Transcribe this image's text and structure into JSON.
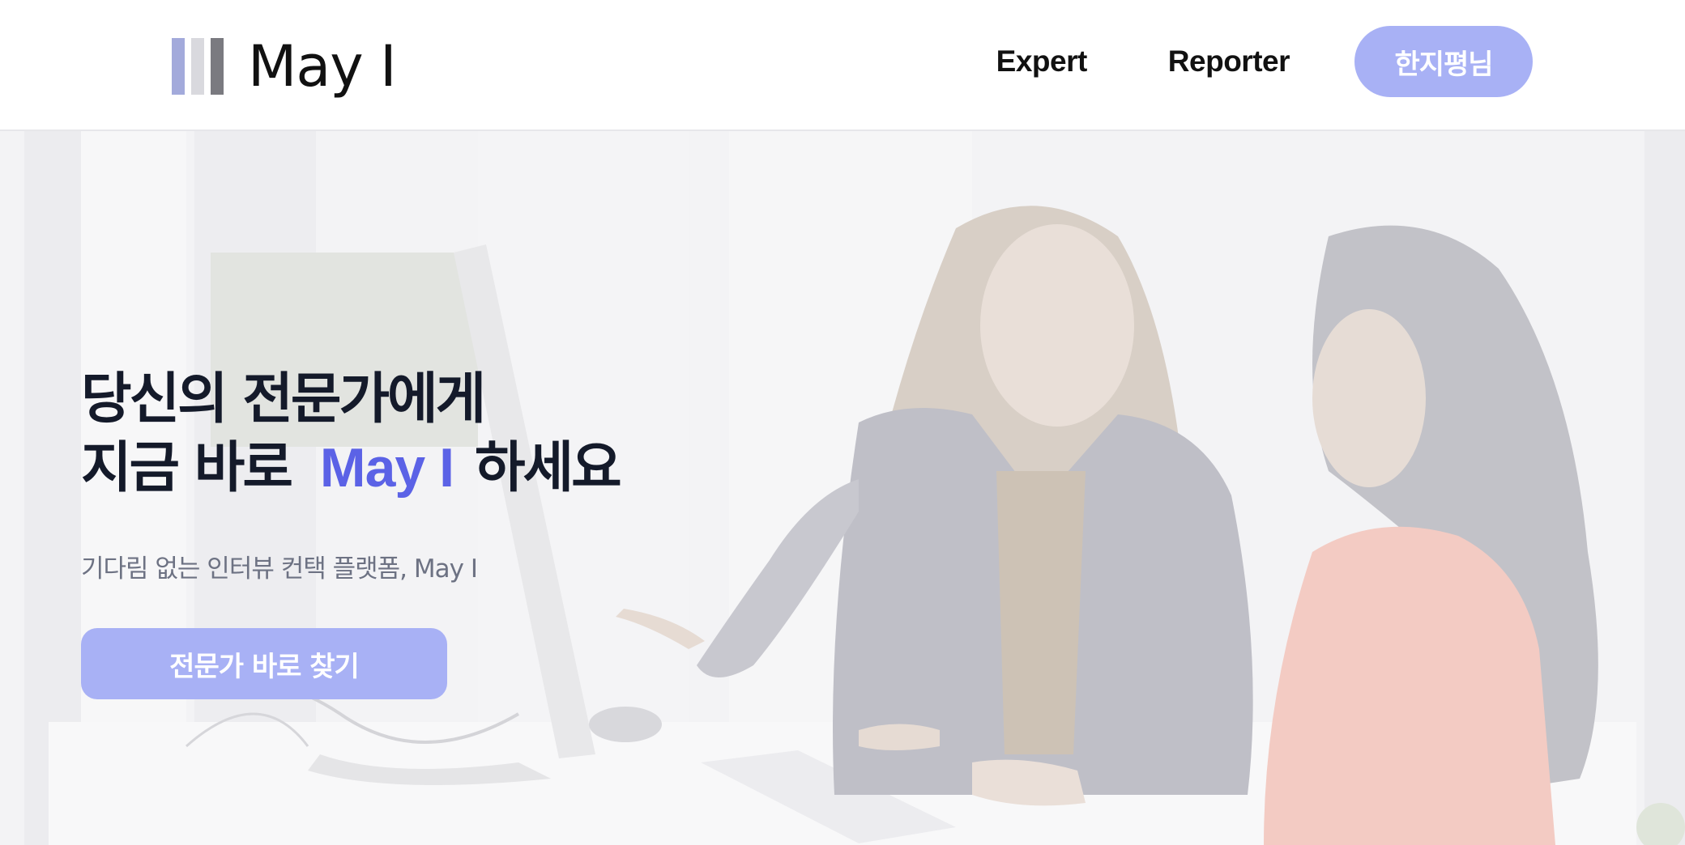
{
  "header": {
    "logo": {
      "text": "May I",
      "bar_colors": [
        "#a3aadb",
        "#d9d9de",
        "#7a7a80"
      ]
    },
    "nav": {
      "expert_label": "Expert",
      "reporter_label": "Reporter"
    },
    "user_button_label": "한지평님"
  },
  "hero": {
    "headline_line1": "당신의 전문가에게",
    "headline_line2_prefix": "지금 바로",
    "headline_line2_accent": "May I",
    "headline_line2_suffix": "하세요",
    "subline": "기다림 없는 인터뷰 컨택 플랫폼, May I",
    "cta_label": "전문가 바로 찾기",
    "background_image": "faded-photo-two-women-talking-at-office-desk-with-computer"
  },
  "colors": {
    "accent": "#5b62e6",
    "button": "#a8b1f5",
    "headline": "#141a2a",
    "subline": "#6d7283"
  }
}
